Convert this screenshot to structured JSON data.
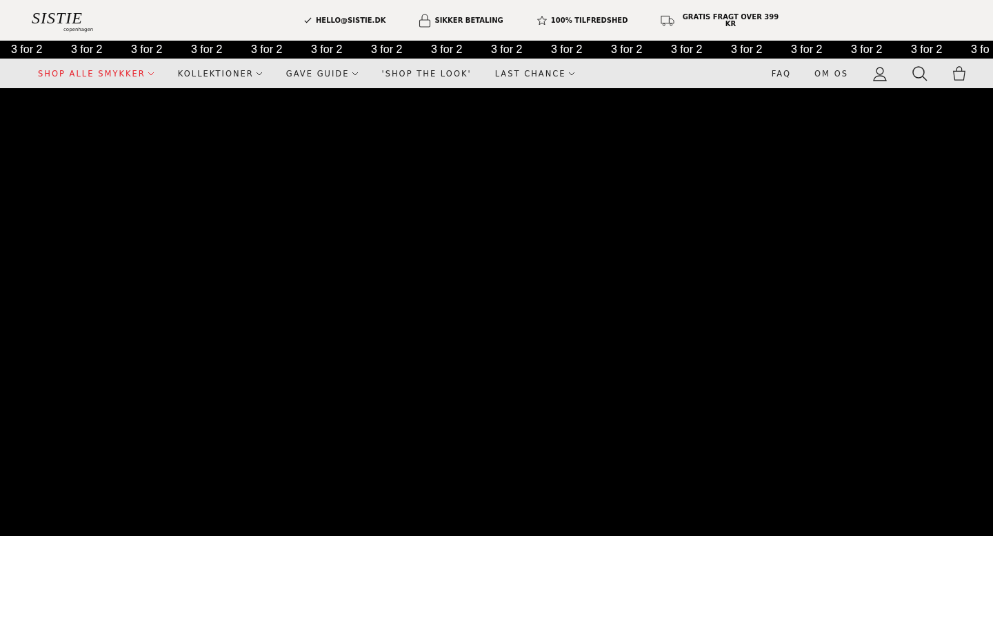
{
  "logo": {
    "name": "SISTIE",
    "tagline": "copenhagen"
  },
  "usps": [
    {
      "kind": "check",
      "text": "HELLO@SISTIE.DK"
    },
    {
      "kind": "lock",
      "text": "SIKKER BETALING"
    },
    {
      "kind": "star",
      "text": "100% TILFREDSHED"
    },
    {
      "kind": "truck",
      "text": "GRATIS FRAGT OVER 399 KR"
    }
  ],
  "ticker": [
    "3 for 2",
    "3 for 2",
    "3 for 2",
    "3 for 2",
    "3 for 2",
    "3 for 2",
    "3 for 2",
    "3 for 2",
    "3 for 2",
    "3 for 2",
    "3 for 2",
    "3 for 2",
    "3 for 2",
    "3 for 2",
    "3 for 2",
    "3 for 2",
    "3 fo"
  ],
  "nav": [
    {
      "label": "SHOP ALLE SMYKKER",
      "dropdown": true,
      "selected": true
    },
    {
      "label": "KOLLEKTIONER",
      "dropdown": true,
      "selected": false
    },
    {
      "label": "GAVE GUIDE",
      "dropdown": true,
      "selected": false
    },
    {
      "label": "'SHOP THE LOOK'",
      "dropdown": false,
      "selected": false
    },
    {
      "label": "LAST CHANCE",
      "dropdown": true,
      "selected": false
    }
  ],
  "nav_right": [
    "FAQ",
    "OM OS"
  ],
  "hero": {
    "kind": "video"
  }
}
